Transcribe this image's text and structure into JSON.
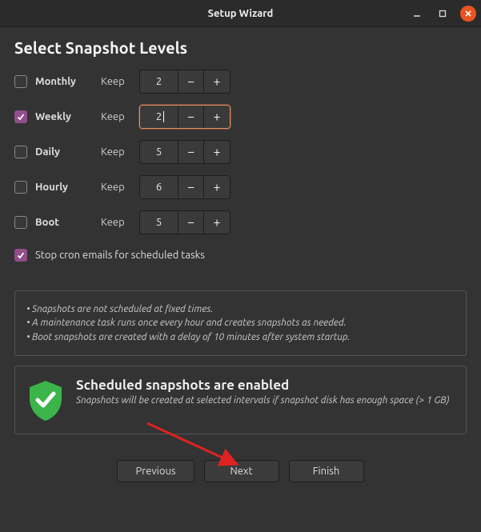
{
  "window": {
    "title": "Setup Wizard"
  },
  "page": {
    "heading": "Select Snapshot Levels"
  },
  "levels": [
    {
      "id": "monthly",
      "label": "Monthly",
      "keep_label": "Keep",
      "value": "2",
      "checked": false,
      "focused": false
    },
    {
      "id": "weekly",
      "label": "Weekly",
      "keep_label": "Keep",
      "value": "2",
      "checked": true,
      "focused": true
    },
    {
      "id": "daily",
      "label": "Daily",
      "keep_label": "Keep",
      "value": "5",
      "checked": false,
      "focused": false
    },
    {
      "id": "hourly",
      "label": "Hourly",
      "keep_label": "Keep",
      "value": "6",
      "checked": false,
      "focused": false
    },
    {
      "id": "boot",
      "label": "Boot",
      "keep_label": "Keep",
      "value": "5",
      "checked": false,
      "focused": false
    }
  ],
  "stop_cron": {
    "checked": true,
    "label": "Stop cron emails for scheduled tasks"
  },
  "info": {
    "line1": "• Snapshots are not scheduled at fixed times.",
    "line2": "• A maintenance task runs once every hour and creates snapshots as needed.",
    "line3": "• Boot snapshots are created with a delay of 10 minutes after system startup."
  },
  "status": {
    "title": "Scheduled snapshots are enabled",
    "subtitle": "Snapshots will be created at selected intervals if snapshot disk has enough space (> 1 GB)"
  },
  "buttons": {
    "previous": "Previous",
    "next": "Next",
    "finish": "Finish"
  }
}
